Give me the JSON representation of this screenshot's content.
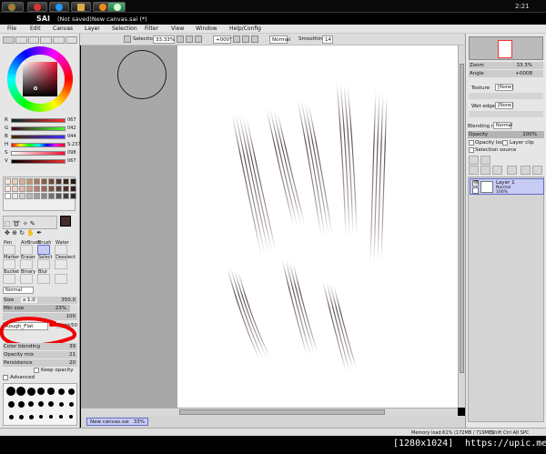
{
  "taskbar": {
    "clock": "2:21"
  },
  "window": {
    "app_name": "SAI",
    "title": "(Not saved)New canvas.sai (*)"
  },
  "menu": [
    "File",
    "Edit",
    "Canvas",
    "Layer",
    "Selection",
    "Filter",
    "View",
    "Window",
    "Help/Config"
  ],
  "toolbar": {
    "selection_label": "Selection",
    "zoom": "33.33%",
    "rotation": "+000°",
    "blend_mode": "Normal",
    "smoothing_label": "Smoothing",
    "smoothing_value": "14"
  },
  "color": {
    "sliders": [
      {
        "label": "R",
        "value": "067"
      },
      {
        "label": "G",
        "value": "042"
      },
      {
        "label": "B",
        "value": "044"
      },
      {
        "label": "H",
        "value": "S:237"
      },
      {
        "label": "S",
        "value": "098"
      },
      {
        "label": "V",
        "value": "067"
      }
    ],
    "current_color": "#432a2c"
  },
  "tools": {
    "row1": [
      "Pen",
      "AirBrush",
      "Brush",
      "Water"
    ],
    "row2": [
      "Marker",
      "Eraser",
      "Select",
      "Deselect"
    ],
    "row3": [
      "Bucket",
      "Binary",
      "Blur",
      ""
    ]
  },
  "brush": {
    "mode": "Normal",
    "size_label": "Size",
    "size_mult": "x 1.0",
    "size_value": "350.0",
    "min_size_label": "Min size",
    "min_size_value": "23%",
    "density_value": "100",
    "texture": "Rough_Flat",
    "dens_label": "Dens",
    "dens_value": "50",
    "color_blending_label": "Color blending",
    "color_blending_value": "39",
    "opacity_mix_label": "Opacity mix",
    "opacity_mix_value": "21",
    "persistence_label": "Persistence",
    "persistence_value": "20",
    "keep_opacity_label": "Keep opacity",
    "advanced_label": "Advanced"
  },
  "navigator": {
    "zoom_label": "Zoom",
    "zoom_value": "33.3%",
    "angle_label": "Angle",
    "angle_value": "+0008"
  },
  "layer_props": {
    "texture_label": "Texture",
    "texture_value": "[None]",
    "wet_edge_label": "Wet edge",
    "wet_edge_value": "[None]",
    "blend_label": "Blending mode",
    "blend_value": "Normal",
    "opacity_label": "Opacity",
    "opacity_value": "100%",
    "opacity_fraction": 1.0,
    "preserve_label": "Opacity lock",
    "clip_label": "Layer clip",
    "selection_source_label": "Selection source"
  },
  "layers": [
    {
      "name": "Layer 1",
      "mode": "Normal",
      "opacity": "100%"
    }
  ],
  "document_tab": {
    "name": "New canvas.sai",
    "zoom": "33%"
  },
  "status": {
    "memory": "Memory load:61% (172MB / 719MB)",
    "keys": "Shift Ctrl Alt SPC"
  },
  "watermark": {
    "resolution": "[1280x1024]",
    "url": "https://upic.me/"
  }
}
